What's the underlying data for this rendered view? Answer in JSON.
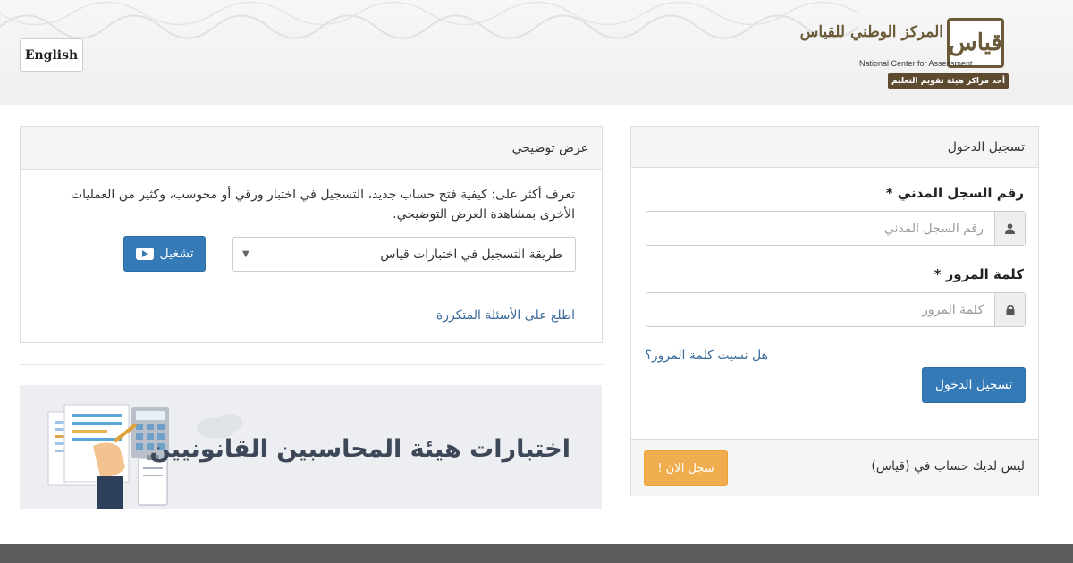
{
  "header": {
    "lang_button": "English",
    "logo": {
      "mark": "قياس",
      "name_ar": "المركز الوطني للقياس",
      "name_en": "National Center for Assessment",
      "ribbon": "أحد مراكز هيئة تقويم التعليم"
    }
  },
  "login": {
    "title": "تسجيل الدخول",
    "id_label": "رقم السجل المدني *",
    "id_placeholder": "رقم السجل المدني",
    "password_label": "كلمة المرور *",
    "password_placeholder": "كلمة المرور",
    "forgot_link": "هل نسيت كلمة المرور؟",
    "submit": "تسجيل الدخول",
    "no_account": "ليس لديك حساب في (قياس)",
    "register_button": "سجل الان !"
  },
  "demo": {
    "title": "عرض توضيحي",
    "description": "تعرف أكثر على: كيفية فتح حساب جديد، التسجيل في اختبار ورقي أو محوسب، وكثير من العمليات الأخرى بمشاهدة العرض التوضيحي.",
    "select_value": "طريقة التسجيل في اختبارات قياس",
    "play_button": "تشغيل",
    "faq_link": "اطلع على الأسئلة المتكررة"
  },
  "banner": {
    "text": "اختبارات هيئة المحاسبين القانونيين"
  },
  "colors": {
    "primary": "#337ab7",
    "warning": "#f0ad4e",
    "link": "#3a6a9a",
    "brand": "#6b5a38"
  },
  "icons": {
    "user": "user-icon",
    "lock": "lock-icon",
    "play": "youtube-play-icon",
    "dropdown": "caret-down-icon"
  }
}
